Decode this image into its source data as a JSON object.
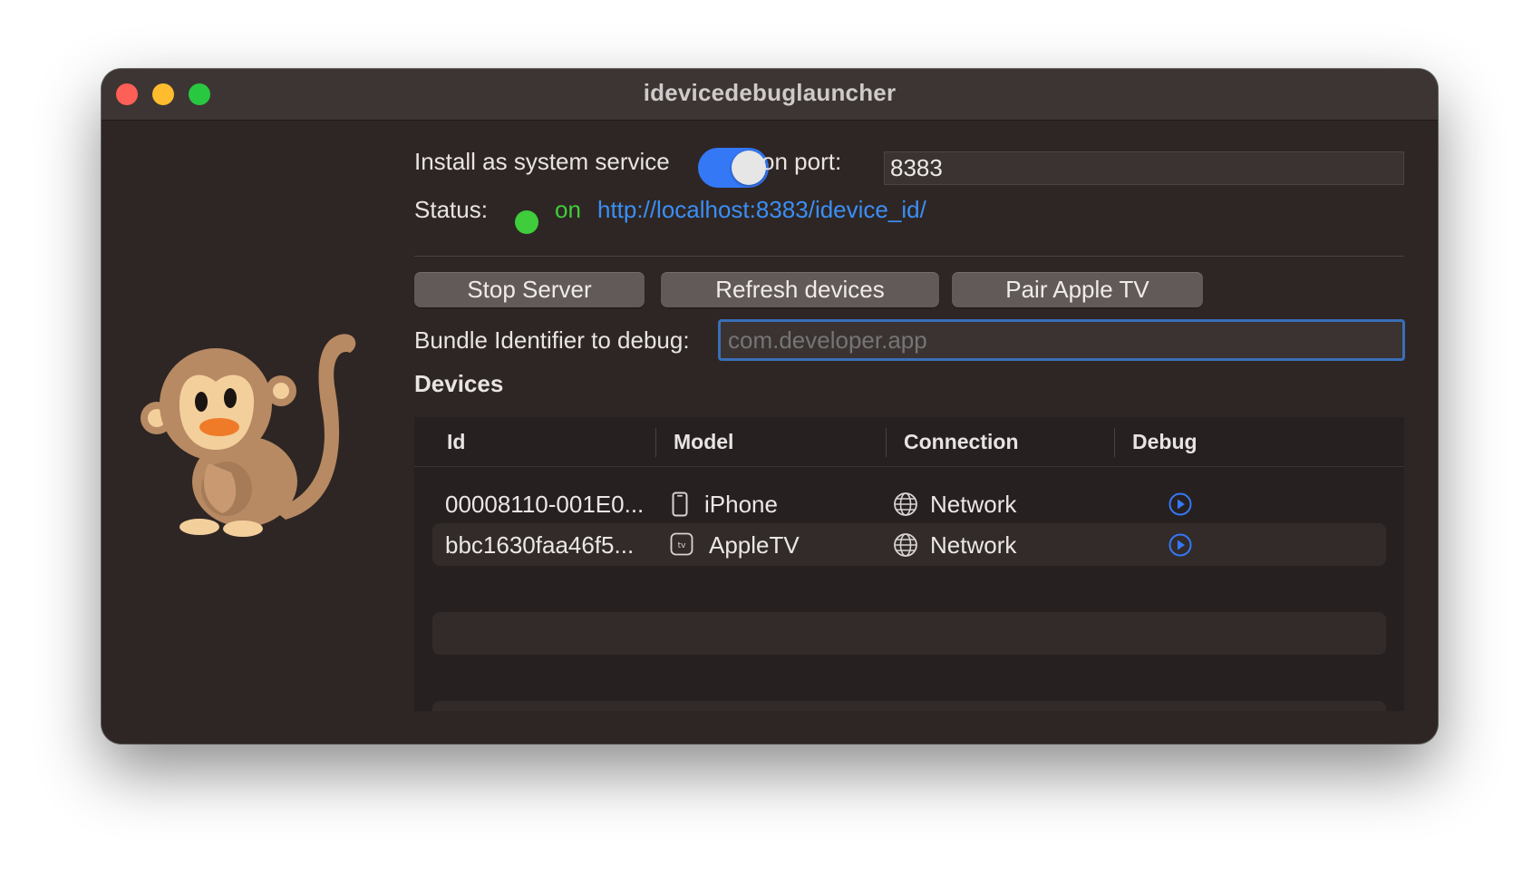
{
  "window": {
    "title": "idevicedebuglauncher"
  },
  "service": {
    "install_label": "Install as system service",
    "toggle_on": true,
    "port_label": "on port:",
    "port_value": "8383"
  },
  "status": {
    "label": "Status:",
    "state": "on",
    "url": "http://localhost:8383/idevice_id/"
  },
  "buttons": {
    "stop_server": "Stop Server",
    "refresh_devices": "Refresh devices",
    "pair_apple_tv": "Pair Apple TV"
  },
  "bundle": {
    "label": "Bundle Identifier to debug:",
    "placeholder": "com.developer.app",
    "value": ""
  },
  "devices": {
    "heading": "Devices",
    "columns": [
      "Id",
      "Model",
      "Connection",
      "Debug"
    ],
    "rows": [
      {
        "id": "00008110-001E0...",
        "model": "iPhone",
        "model_icon": "iphone-icon",
        "connection": "Network",
        "connection_icon": "globe-icon",
        "debug_icon": "play-circle-icon"
      },
      {
        "id": "bbc1630faa46f5...",
        "model": "AppleTV",
        "model_icon": "appletv-icon",
        "connection": "Network",
        "connection_icon": "globe-icon",
        "debug_icon": "play-circle-icon"
      }
    ]
  },
  "colors": {
    "accent": "#3478f6",
    "status_on": "#3fcd3b",
    "link": "#3a8ff6",
    "window_bg": "#2e2624"
  }
}
